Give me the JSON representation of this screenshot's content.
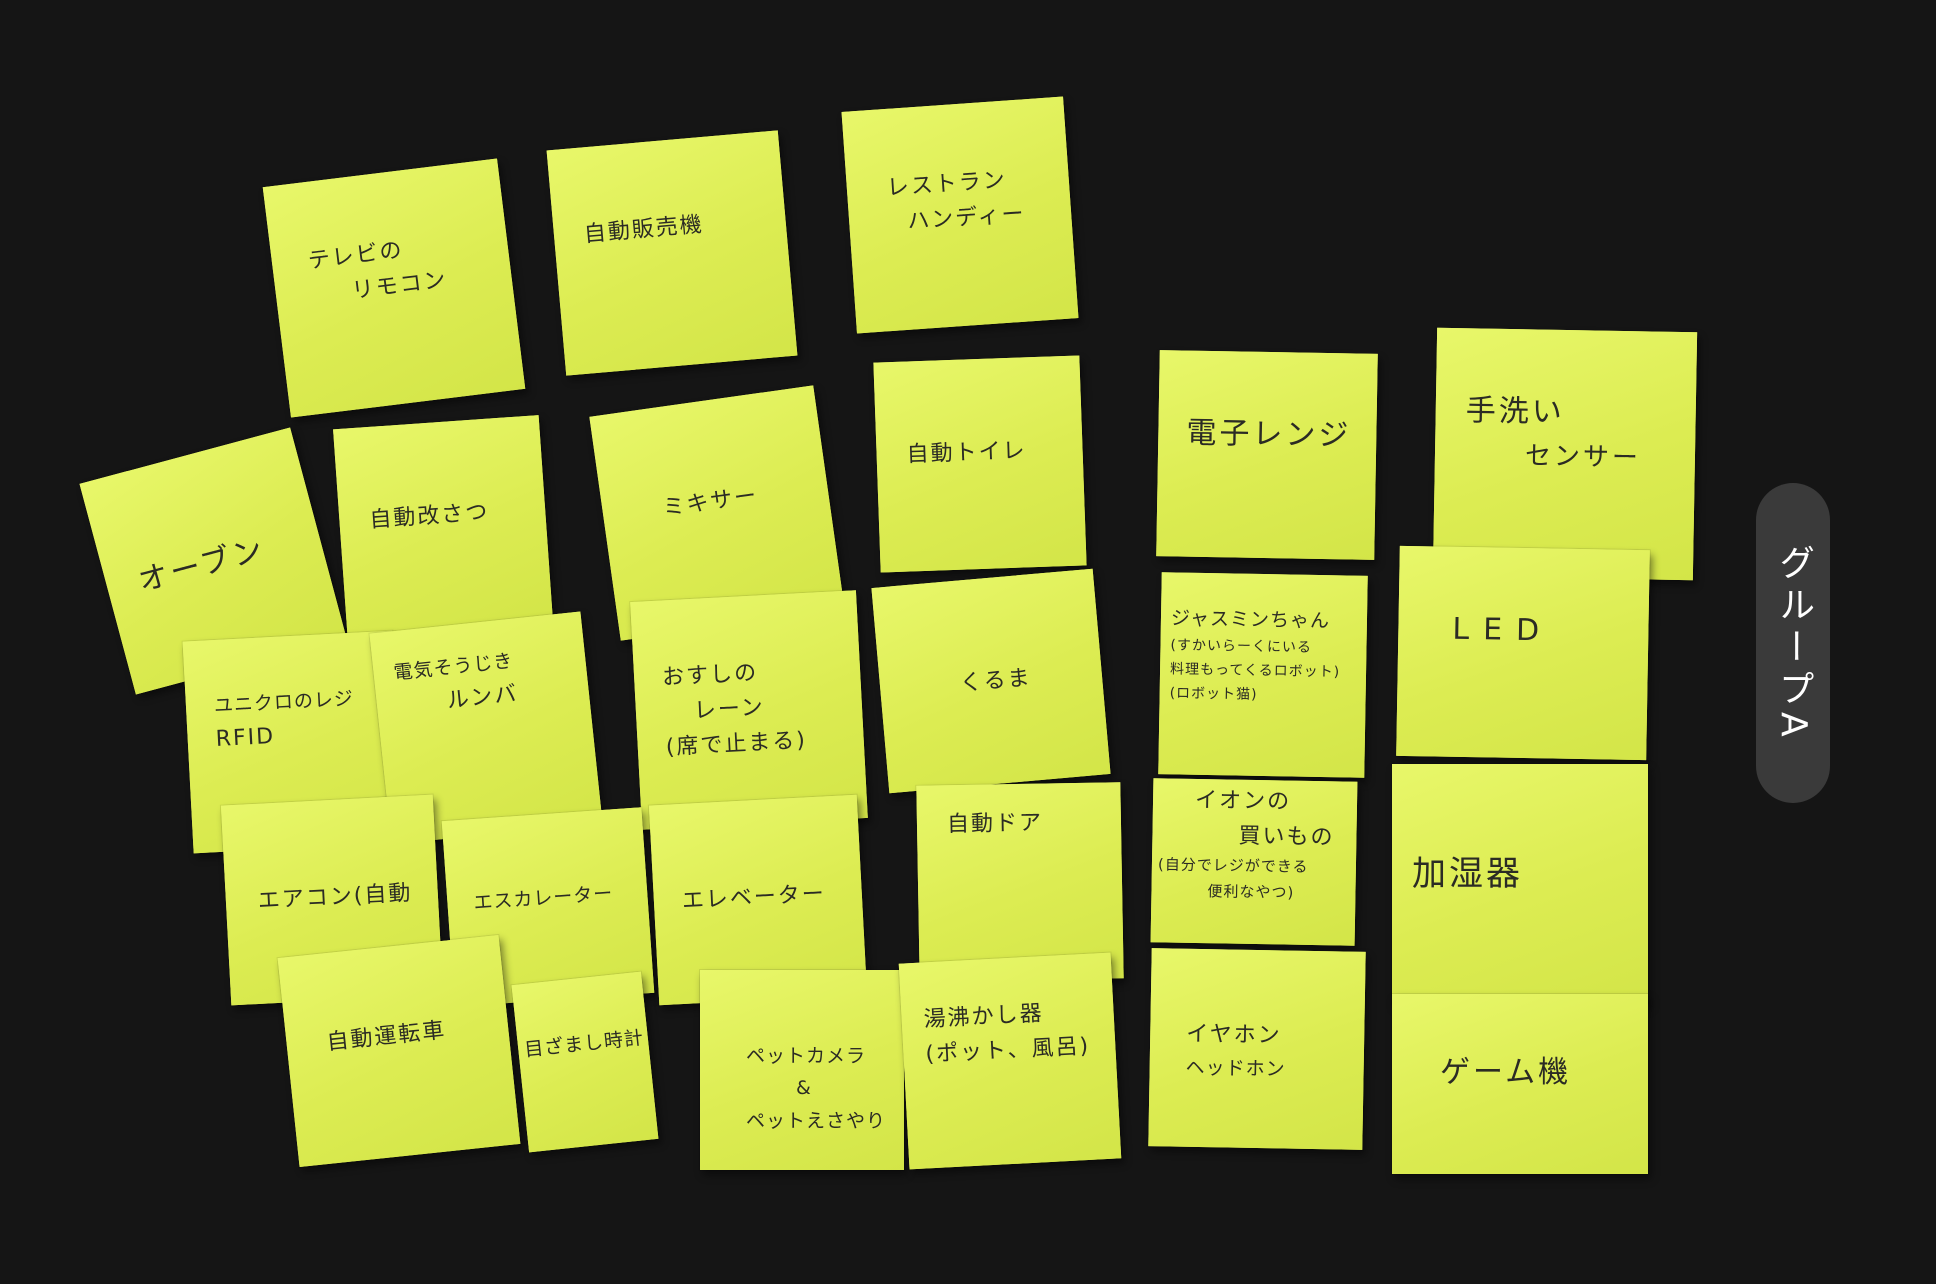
{
  "group_label": "グループA",
  "notes": [
    {
      "lines": [
        "テレビの",
        "リモコン"
      ]
    },
    {
      "lines": [
        "自動販売機"
      ]
    },
    {
      "lines": [
        "レストラン",
        "ハンディー"
      ]
    },
    {
      "lines": [
        "オーブン"
      ]
    },
    {
      "lines": [
        "自動改さつ"
      ]
    },
    {
      "lines": [
        "ミキサー"
      ]
    },
    {
      "lines": [
        "自動トイレ"
      ]
    },
    {
      "lines": [
        "電子レンジ"
      ]
    },
    {
      "lines": [
        "手洗い",
        "センサー"
      ]
    },
    {
      "lines": [
        "ユニクロのレジ",
        "RFID"
      ]
    },
    {
      "lines": [
        "電気そうじき",
        "ルンバ"
      ]
    },
    {
      "lines": [
        "おすしの",
        "レーン",
        "(席で止まる)"
      ]
    },
    {
      "lines": [
        "くるま"
      ]
    },
    {
      "lines": [
        "ジャスミンちゃん",
        "(すかいらーくにいる",
        "料理もってくるロボット)",
        "(ロボット猫)"
      ]
    },
    {
      "lines": [
        "LED"
      ]
    },
    {
      "lines": [
        "エアコン(自動"
      ]
    },
    {
      "lines": [
        "エスカレーター"
      ]
    },
    {
      "lines": [
        "エレベーター"
      ]
    },
    {
      "lines": [
        "自動ドア"
      ]
    },
    {
      "lines": [
        "イオンの",
        "買いもの",
        "(自分でレジができる",
        "便利なやつ)"
      ]
    },
    {
      "lines": [
        "加湿器"
      ]
    },
    {
      "lines": [
        "自動運転車"
      ]
    },
    {
      "lines": [
        "目ざまし時計"
      ]
    },
    {
      "lines": [
        "ペットカメラ",
        "&",
        "ペットえさやり"
      ]
    },
    {
      "lines": [
        "湯沸かし器",
        "(ポット、風呂)"
      ]
    },
    {
      "lines": [
        "イヤホン",
        "ヘッドホン"
      ]
    },
    {
      "lines": [
        "ゲーム機"
      ]
    }
  ]
}
